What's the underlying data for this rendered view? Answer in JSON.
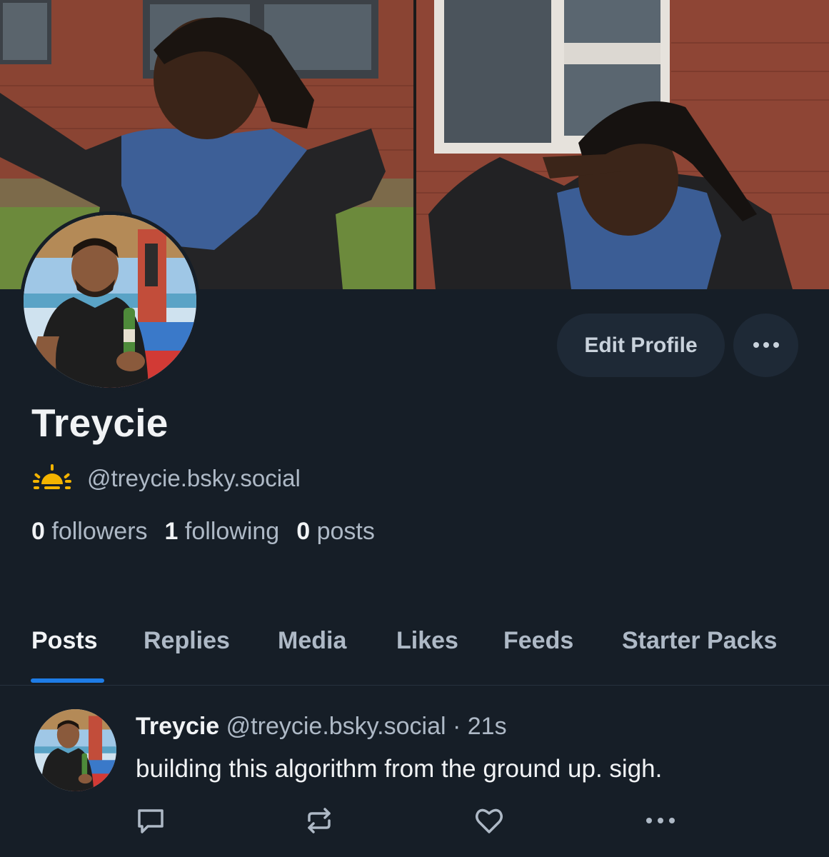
{
  "profile": {
    "display_name": "Treycie",
    "handle": "@treycie.bsky.social",
    "handle_icon": "sunrise-emoji-icon",
    "edit_button_label": "Edit Profile",
    "more_icon": "ellipsis-icon",
    "stats": {
      "followers_count": "0",
      "followers_label": "followers",
      "following_count": "1",
      "following_label": "following",
      "posts_count": "0",
      "posts_label": "posts"
    }
  },
  "tabs": [
    {
      "label": "Posts",
      "active": true
    },
    {
      "label": "Replies",
      "active": false
    },
    {
      "label": "Media",
      "active": false
    },
    {
      "label": "Likes",
      "active": false
    },
    {
      "label": "Feeds",
      "active": false
    },
    {
      "label": "Starter Packs",
      "active": false
    }
  ],
  "post": {
    "author": "Treycie",
    "handle": "@treycie.bsky.social",
    "separator": "·",
    "time": "21s",
    "text": "building this algorithm from the ground up. sigh.",
    "actions": [
      "reply-icon",
      "repost-icon",
      "like-icon",
      "more-icon"
    ]
  },
  "colors": {
    "background": "#161e27",
    "button_bg": "#1e2936",
    "muted_text": "#aeb9c6",
    "accent": "#1e7ce6"
  }
}
